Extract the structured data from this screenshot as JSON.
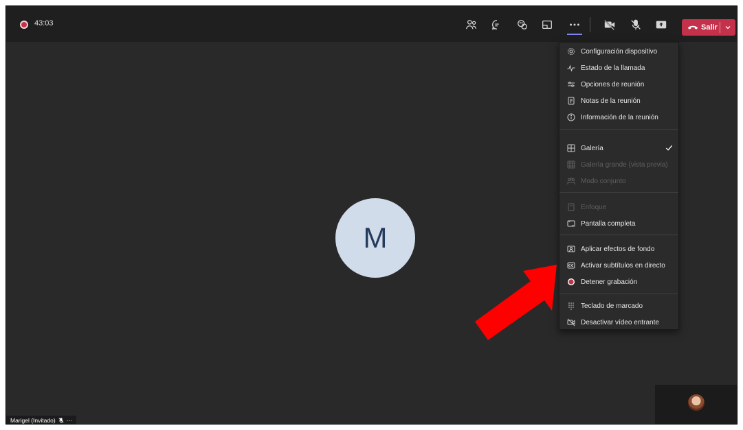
{
  "colors": {
    "accent": "#7f85f5",
    "leave_red": "#c4314b",
    "background": "#292929",
    "topbar": "#1f1f1f",
    "arrow": "#ff0000"
  },
  "topbar": {
    "recording_timer": "43:03",
    "icons": [
      "people-icon",
      "chat-icon",
      "reactions-icon",
      "rooms-icon",
      "more-actions-icon",
      "camera-off-icon",
      "mic-off-icon",
      "share-icon"
    ],
    "leave_label": "Salir"
  },
  "stage": {
    "participant_initial": "M"
  },
  "menu": {
    "items": [
      {
        "label": "Configuración dispositivo",
        "icon": "gear-icon"
      },
      {
        "label": "Estado de la llamada",
        "icon": "pulse-icon"
      },
      {
        "label": "Opciones de reunión",
        "icon": "sliders-icon"
      },
      {
        "label": "Notas de la reunión",
        "icon": "notes-icon"
      },
      {
        "label": "Información de la reunión",
        "icon": "info-icon"
      },
      {
        "label": "Galería",
        "icon": "gallery-icon",
        "checked": true
      },
      {
        "label": "Galería grande (vista previa)",
        "icon": "large-gallery-icon",
        "disabled": true
      },
      {
        "label": "Modo conjunto",
        "icon": "together-mode-icon",
        "disabled": true
      },
      {
        "label": "Enfoque",
        "icon": "focus-icon",
        "disabled": true
      },
      {
        "label": "Pantalla completa",
        "icon": "fullscreen-icon"
      },
      {
        "label": "Aplicar efectos de fondo",
        "icon": "background-effects-icon"
      },
      {
        "label": "Activar subtítulos en directo",
        "icon": "captions-icon"
      },
      {
        "label": "Detener grabación",
        "icon": "stop-recording-icon"
      },
      {
        "label": "Teclado de marcado",
        "icon": "dialpad-icon"
      },
      {
        "label": "Desactivar vídeo entrante",
        "icon": "incoming-video-off-icon"
      }
    ]
  },
  "footer": {
    "participant_name": "Marigel (Invitado)",
    "more_label": "···"
  }
}
